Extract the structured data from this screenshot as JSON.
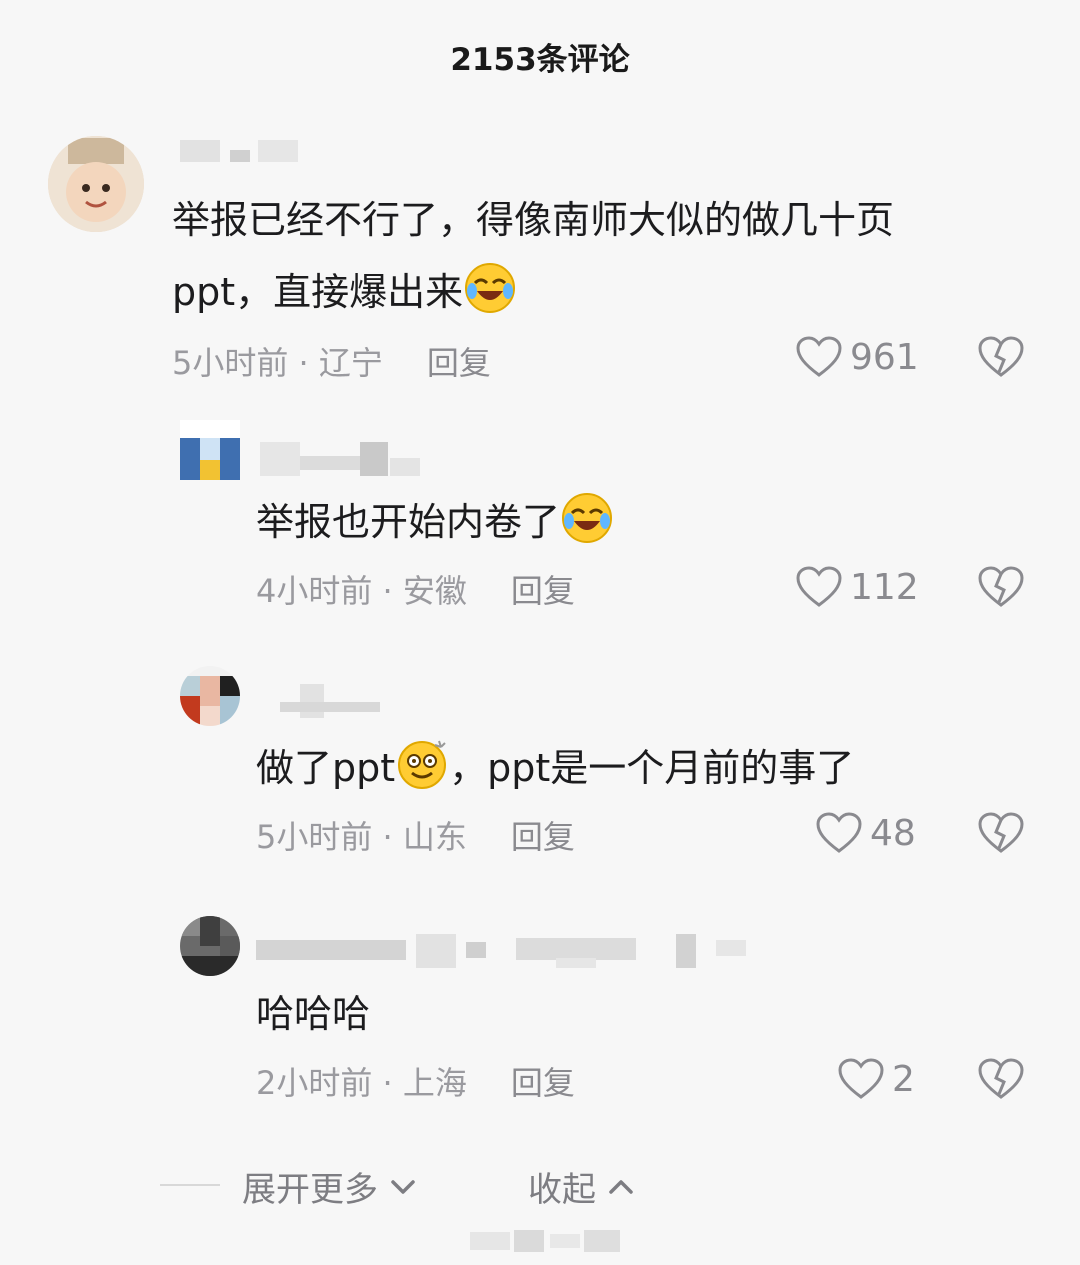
{
  "header": {
    "title": "2153条评论"
  },
  "comments": [
    {
      "text_part1": "举报已经不行了，得像南师大似的做几十页",
      "text_part2": "ppt，直接爆出来",
      "emoji": "laughing-crying-emoji",
      "time_location": "5小时前 · 辽宁",
      "reply_label": "回复",
      "likes": "961"
    },
    {
      "text": "举报也开始内卷了",
      "emoji": "laughing-crying-emoji",
      "time_location": "4小时前 · 安徽",
      "reply_label": "回复",
      "likes": "112"
    },
    {
      "text_before": "做了ppt",
      "emoji": "dizzy-smile-emoji",
      "text_after": "，ppt是一个月前的事了",
      "time_location": "5小时前 · 山东",
      "reply_label": "回复",
      "likes": "48"
    },
    {
      "text": "哈哈哈",
      "time_location": "2小时前 · 上海",
      "reply_label": "回复",
      "likes": "2"
    }
  ],
  "footer": {
    "expand_label": "展开更多",
    "collapse_label": "收起"
  },
  "icons": {
    "like": "heart-icon",
    "dislike": "broken-heart-icon",
    "expand": "chevron-down-icon",
    "collapse": "chevron-up-icon"
  },
  "colors": {
    "text": "#1c1c1e",
    "meta": "#9a9a9f",
    "background": "#f7f7f7"
  }
}
